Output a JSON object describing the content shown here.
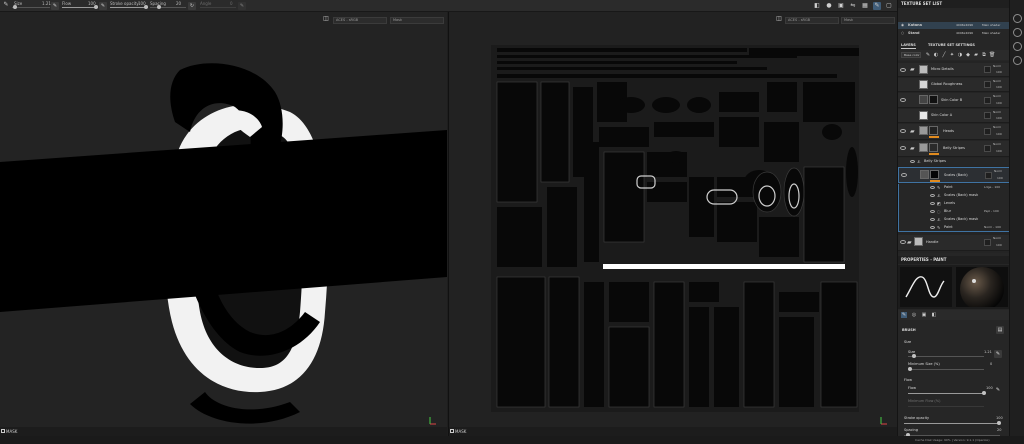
{
  "toolbar": {
    "size_label": "Size",
    "size_value": "1.21",
    "flow_label": "Flow",
    "flow_value": "100",
    "stroke_opacity_label": "Stroke opacity",
    "stroke_opacity_value": "100",
    "spacing_label": "Spacing",
    "spacing_value": "20",
    "angle_label": "Angle",
    "angle_value": "0"
  },
  "viewport_left": {
    "camera_dropdown": "ACES - sRGB",
    "channel_dropdown": "Mask",
    "footer_label": "MASK"
  },
  "viewport_right": {
    "camera_dropdown": "ACES - sRGB",
    "channel_dropdown": "Mask",
    "footer_label": "MASK"
  },
  "texture_set_list": {
    "title": "TEXTURE SET LIST",
    "rows": [
      {
        "name": "Katana",
        "res": "4096x4096",
        "shader": "Main shader",
        "selected": true
      },
      {
        "name": "Stand",
        "res": "4096x4096",
        "shader": "Main shader",
        "selected": false
      }
    ]
  },
  "layer_tabs": {
    "layers": "LAYERS",
    "settings": "TEXTURE SET SETTINGS"
  },
  "layer_tools": {
    "channel": "Base color"
  },
  "layers": [
    {
      "name": "Micro Details",
      "blend": "Norm",
      "opacity": "100",
      "type": "folder"
    },
    {
      "name": "Global Roughness",
      "blend": "Norm",
      "opacity": "100",
      "type": "fill"
    },
    {
      "name": "Skin Color B",
      "blend": "Norm",
      "opacity": "100",
      "type": "fill"
    },
    {
      "name": "Skin Color A",
      "blend": "Norm",
      "opacity": "100",
      "type": "fill"
    },
    {
      "name": "Heads",
      "blend": "Norm",
      "opacity": "100",
      "type": "folder"
    },
    {
      "name": "Belly Stripes",
      "blend": "Norm",
      "opacity": "100",
      "type": "folder"
    },
    {
      "name": "Scales (Back)",
      "blend": "Norm",
      "opacity": "100",
      "type": "fill",
      "selected": true
    },
    {
      "name": "Handle",
      "blend": "Norm",
      "opacity": "100",
      "type": "folder"
    }
  ],
  "belly_stripes_sub": "Belly Stripes",
  "scales_sub": [
    {
      "name": "Paint",
      "extra": "Ldge - 100"
    },
    {
      "name": "Scales (Back) mask",
      "extra": ""
    },
    {
      "name": "Levels",
      "extra": ""
    },
    {
      "name": "Blur",
      "extra": "Pspl - 100"
    },
    {
      "name": "Scales (Back) mask",
      "extra": ""
    },
    {
      "name": "Paint",
      "extra": "Norm - 100"
    }
  ],
  "properties": {
    "title": "PROPERTIES - PAINT",
    "section": "BRUSH",
    "size_group": "Size",
    "size_label": "Size",
    "size_value": "1.21",
    "min_size_label": "Minimum Size (%)",
    "min_size_value": "0",
    "flow_group": "Flow",
    "flow_label": "Flow",
    "flow_value": "100",
    "min_flow_label": "Minimum Flow (%)",
    "stroke_opacity_label": "Stroke opacity",
    "stroke_opacity_value": "100",
    "spacing_label": "Spacing",
    "spacing_value": "20",
    "flow_fill": 1.0,
    "size_fill": 0.05,
    "min_size_fill": 0.0
  },
  "status": {
    "text": "Cache Disk Usage:  90% | Version: 9.1.1 (OpenGL)"
  },
  "icons": [
    "brush-icon",
    "eraser-icon",
    "projection-icon",
    "eye-icon",
    "folder-icon",
    "gear-icon",
    "camera-icon"
  ]
}
